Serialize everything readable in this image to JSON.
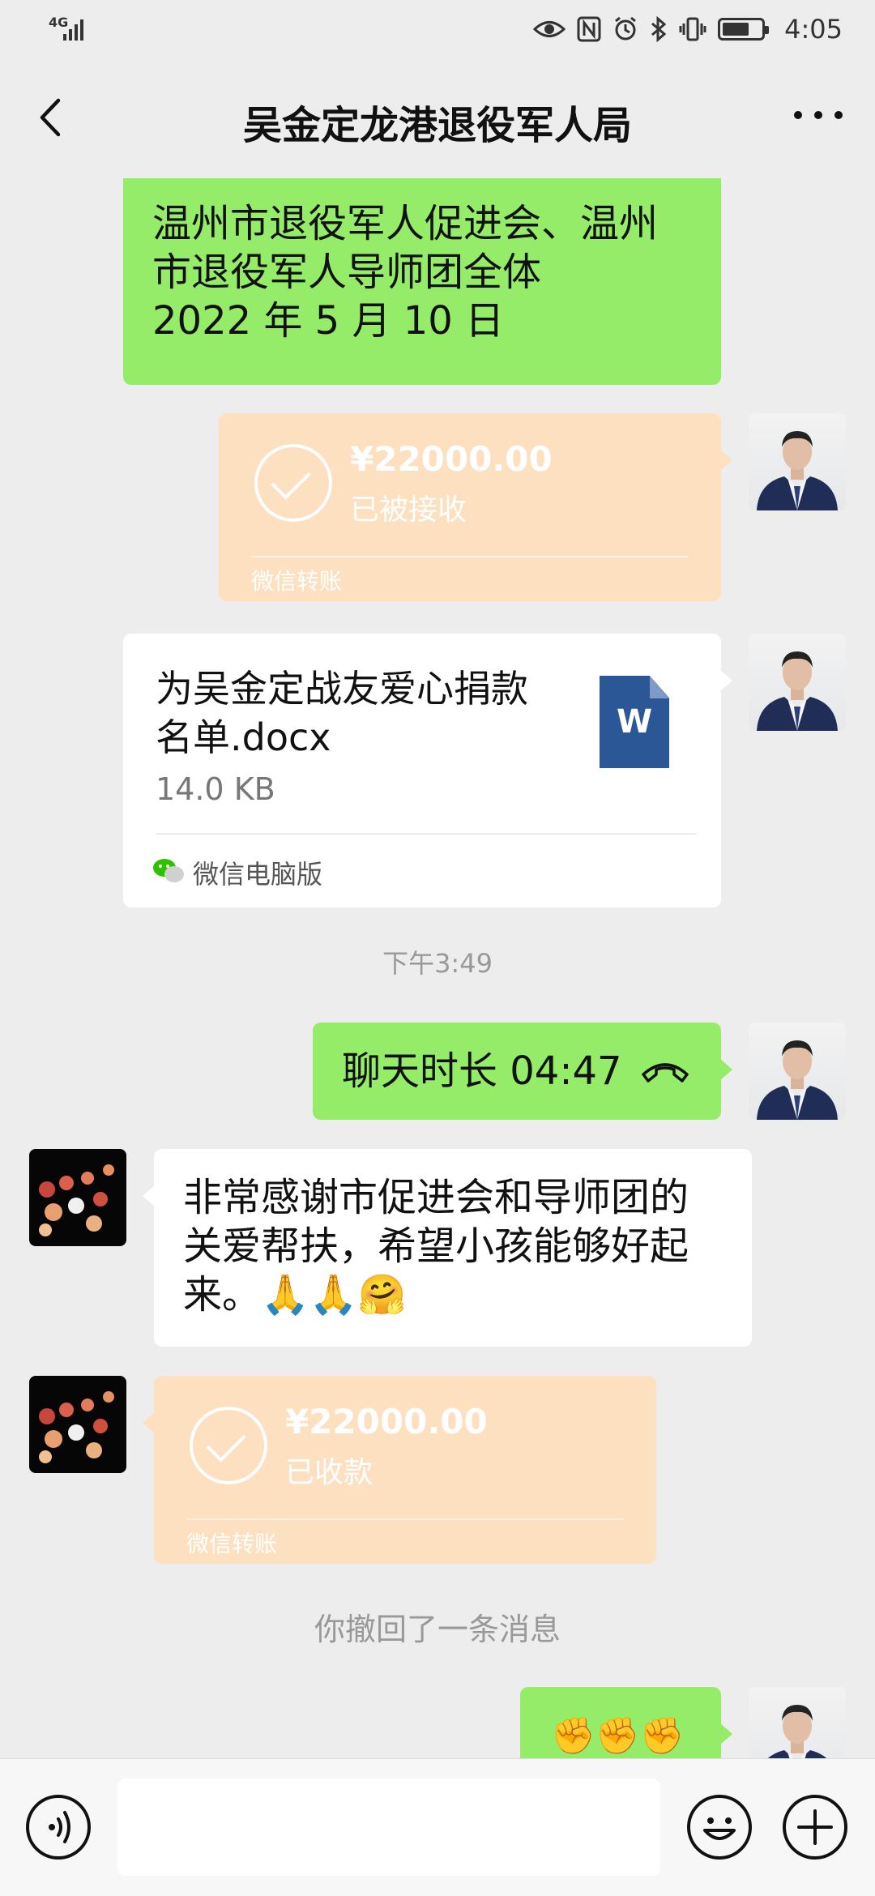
{
  "status_bar": {
    "network": "4G",
    "time": "4:05",
    "battery_level": 0.7,
    "icons": [
      "eye-icon",
      "nfc-icon",
      "alarm-icon",
      "bluetooth-icon",
      "vibrate-icon",
      "battery-icon"
    ]
  },
  "header": {
    "title": "吴金定龙港退役军人局",
    "back_icon": "chevron-left-icon",
    "more_icon": "more-dots-icon"
  },
  "messages": {
    "m1_lines": [
      "温州市退役军人促进会、温州",
      "市退役军人导师团全体",
      "2022 年 5 月 10 日"
    ],
    "transfer1": {
      "amount": "¥22000.00",
      "status": "已被接收",
      "footer": "微信转账"
    },
    "file": {
      "name_lines": [
        "为吴金定战友爱心捐款",
        "名单.docx"
      ],
      "size": "14.0 KB",
      "icon_letter": "W",
      "source": "微信电脑版"
    },
    "timestamp": "下午3:49",
    "call": {
      "label": "聊天时长 04:47",
      "icon": "phone-hangup-icon"
    },
    "reply_lines": [
      "非常感谢市促进会和导师团的",
      "关爱帮扶，希望小孩能够好起",
      "来。🙏🙏🤗"
    ],
    "transfer2": {
      "amount": "¥22000.00",
      "status": "已收款",
      "footer": "微信转账"
    },
    "recall_notice": "你撤回了一条消息",
    "last_emoji": "✊✊✊"
  },
  "input_bar": {
    "voice_icon": "voice-icon",
    "placeholder": "",
    "emoji_icon": "emoji-icon",
    "plus_icon": "plus-icon"
  },
  "colors": {
    "background": "#ededed",
    "my_bubble": "#95ec69",
    "their_bubble": "#ffffff",
    "transfer_card": "#fde0c0"
  }
}
